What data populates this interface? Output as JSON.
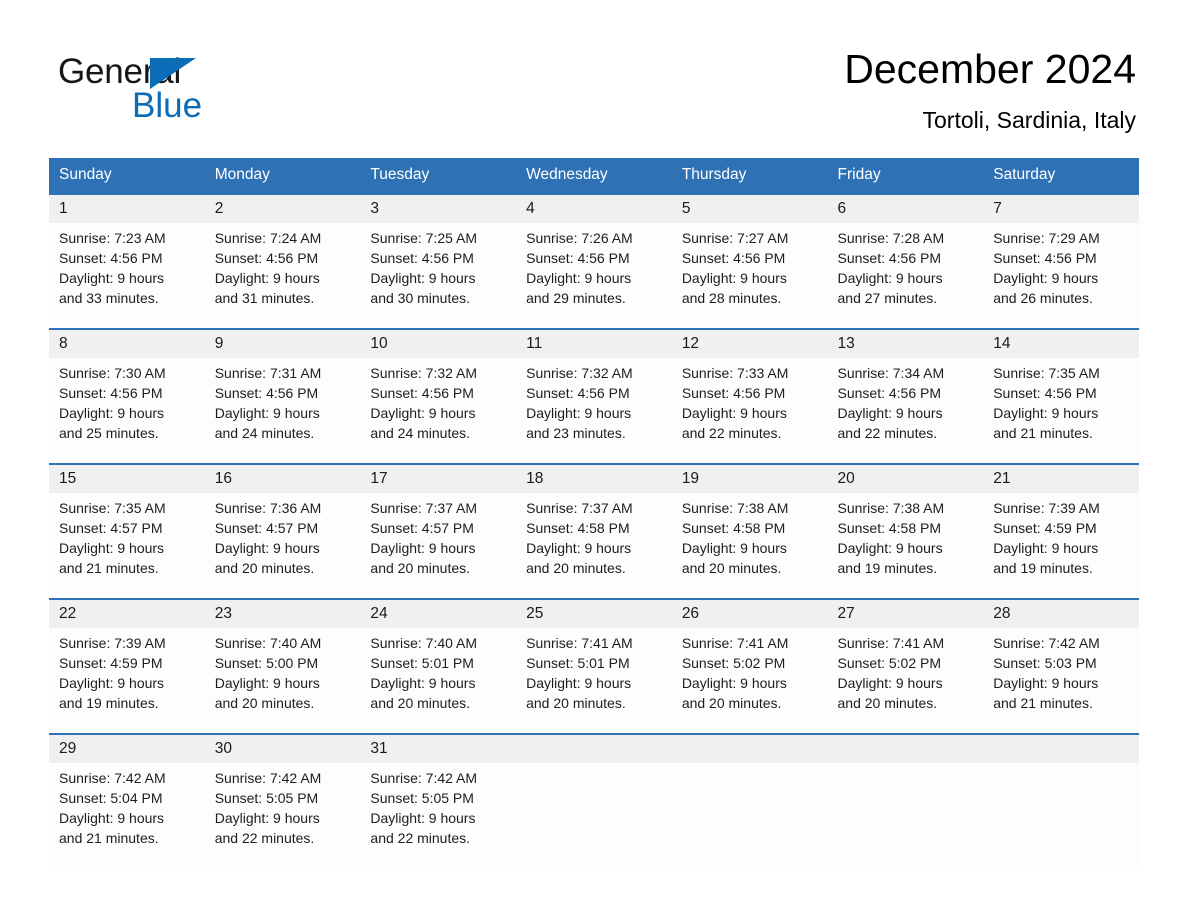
{
  "brand": {
    "name_part1": "General",
    "name_part2": "Blue",
    "accent_color": "#0b6cb7"
  },
  "header": {
    "title": "December 2024",
    "subtitle": "Tortoli, Sardinia, Italy"
  },
  "theme": {
    "header_blue": "#2e72b5",
    "daynum_band": "#f0f0f0",
    "cell_background": "#fdfdfd",
    "text_color": "#1d1d1d"
  },
  "weekday_headers": [
    "Sunday",
    "Monday",
    "Tuesday",
    "Wednesday",
    "Thursday",
    "Friday",
    "Saturday"
  ],
  "weeks": [
    [
      {
        "day": "1",
        "sunrise": "Sunrise: 7:23 AM",
        "sunset": "Sunset: 4:56 PM",
        "daylight_line1": "Daylight: 9 hours",
        "daylight_line2": "and 33 minutes."
      },
      {
        "day": "2",
        "sunrise": "Sunrise: 7:24 AM",
        "sunset": "Sunset: 4:56 PM",
        "daylight_line1": "Daylight: 9 hours",
        "daylight_line2": "and 31 minutes."
      },
      {
        "day": "3",
        "sunrise": "Sunrise: 7:25 AM",
        "sunset": "Sunset: 4:56 PM",
        "daylight_line1": "Daylight: 9 hours",
        "daylight_line2": "and 30 minutes."
      },
      {
        "day": "4",
        "sunrise": "Sunrise: 7:26 AM",
        "sunset": "Sunset: 4:56 PM",
        "daylight_line1": "Daylight: 9 hours",
        "daylight_line2": "and 29 minutes."
      },
      {
        "day": "5",
        "sunrise": "Sunrise: 7:27 AM",
        "sunset": "Sunset: 4:56 PM",
        "daylight_line1": "Daylight: 9 hours",
        "daylight_line2": "and 28 minutes."
      },
      {
        "day": "6",
        "sunrise": "Sunrise: 7:28 AM",
        "sunset": "Sunset: 4:56 PM",
        "daylight_line1": "Daylight: 9 hours",
        "daylight_line2": "and 27 minutes."
      },
      {
        "day": "7",
        "sunrise": "Sunrise: 7:29 AM",
        "sunset": "Sunset: 4:56 PM",
        "daylight_line1": "Daylight: 9 hours",
        "daylight_line2": "and 26 minutes."
      }
    ],
    [
      {
        "day": "8",
        "sunrise": "Sunrise: 7:30 AM",
        "sunset": "Sunset: 4:56 PM",
        "daylight_line1": "Daylight: 9 hours",
        "daylight_line2": "and 25 minutes."
      },
      {
        "day": "9",
        "sunrise": "Sunrise: 7:31 AM",
        "sunset": "Sunset: 4:56 PM",
        "daylight_line1": "Daylight: 9 hours",
        "daylight_line2": "and 24 minutes."
      },
      {
        "day": "10",
        "sunrise": "Sunrise: 7:32 AM",
        "sunset": "Sunset: 4:56 PM",
        "daylight_line1": "Daylight: 9 hours",
        "daylight_line2": "and 24 minutes."
      },
      {
        "day": "11",
        "sunrise": "Sunrise: 7:32 AM",
        "sunset": "Sunset: 4:56 PM",
        "daylight_line1": "Daylight: 9 hours",
        "daylight_line2": "and 23 minutes."
      },
      {
        "day": "12",
        "sunrise": "Sunrise: 7:33 AM",
        "sunset": "Sunset: 4:56 PM",
        "daylight_line1": "Daylight: 9 hours",
        "daylight_line2": "and 22 minutes."
      },
      {
        "day": "13",
        "sunrise": "Sunrise: 7:34 AM",
        "sunset": "Sunset: 4:56 PM",
        "daylight_line1": "Daylight: 9 hours",
        "daylight_line2": "and 22 minutes."
      },
      {
        "day": "14",
        "sunrise": "Sunrise: 7:35 AM",
        "sunset": "Sunset: 4:56 PM",
        "daylight_line1": "Daylight: 9 hours",
        "daylight_line2": "and 21 minutes."
      }
    ],
    [
      {
        "day": "15",
        "sunrise": "Sunrise: 7:35 AM",
        "sunset": "Sunset: 4:57 PM",
        "daylight_line1": "Daylight: 9 hours",
        "daylight_line2": "and 21 minutes."
      },
      {
        "day": "16",
        "sunrise": "Sunrise: 7:36 AM",
        "sunset": "Sunset: 4:57 PM",
        "daylight_line1": "Daylight: 9 hours",
        "daylight_line2": "and 20 minutes."
      },
      {
        "day": "17",
        "sunrise": "Sunrise: 7:37 AM",
        "sunset": "Sunset: 4:57 PM",
        "daylight_line1": "Daylight: 9 hours",
        "daylight_line2": "and 20 minutes."
      },
      {
        "day": "18",
        "sunrise": "Sunrise: 7:37 AM",
        "sunset": "Sunset: 4:58 PM",
        "daylight_line1": "Daylight: 9 hours",
        "daylight_line2": "and 20 minutes."
      },
      {
        "day": "19",
        "sunrise": "Sunrise: 7:38 AM",
        "sunset": "Sunset: 4:58 PM",
        "daylight_line1": "Daylight: 9 hours",
        "daylight_line2": "and 20 minutes."
      },
      {
        "day": "20",
        "sunrise": "Sunrise: 7:38 AM",
        "sunset": "Sunset: 4:58 PM",
        "daylight_line1": "Daylight: 9 hours",
        "daylight_line2": "and 19 minutes."
      },
      {
        "day": "21",
        "sunrise": "Sunrise: 7:39 AM",
        "sunset": "Sunset: 4:59 PM",
        "daylight_line1": "Daylight: 9 hours",
        "daylight_line2": "and 19 minutes."
      }
    ],
    [
      {
        "day": "22",
        "sunrise": "Sunrise: 7:39 AM",
        "sunset": "Sunset: 4:59 PM",
        "daylight_line1": "Daylight: 9 hours",
        "daylight_line2": "and 19 minutes."
      },
      {
        "day": "23",
        "sunrise": "Sunrise: 7:40 AM",
        "sunset": "Sunset: 5:00 PM",
        "daylight_line1": "Daylight: 9 hours",
        "daylight_line2": "and 20 minutes."
      },
      {
        "day": "24",
        "sunrise": "Sunrise: 7:40 AM",
        "sunset": "Sunset: 5:01 PM",
        "daylight_line1": "Daylight: 9 hours",
        "daylight_line2": "and 20 minutes."
      },
      {
        "day": "25",
        "sunrise": "Sunrise: 7:41 AM",
        "sunset": "Sunset: 5:01 PM",
        "daylight_line1": "Daylight: 9 hours",
        "daylight_line2": "and 20 minutes."
      },
      {
        "day": "26",
        "sunrise": "Sunrise: 7:41 AM",
        "sunset": "Sunset: 5:02 PM",
        "daylight_line1": "Daylight: 9 hours",
        "daylight_line2": "and 20 minutes."
      },
      {
        "day": "27",
        "sunrise": "Sunrise: 7:41 AM",
        "sunset": "Sunset: 5:02 PM",
        "daylight_line1": "Daylight: 9 hours",
        "daylight_line2": "and 20 minutes."
      },
      {
        "day": "28",
        "sunrise": "Sunrise: 7:42 AM",
        "sunset": "Sunset: 5:03 PM",
        "daylight_line1": "Daylight: 9 hours",
        "daylight_line2": "and 21 minutes."
      }
    ],
    [
      {
        "day": "29",
        "sunrise": "Sunrise: 7:42 AM",
        "sunset": "Sunset: 5:04 PM",
        "daylight_line1": "Daylight: 9 hours",
        "daylight_line2": "and 21 minutes."
      },
      {
        "day": "30",
        "sunrise": "Sunrise: 7:42 AM",
        "sunset": "Sunset: 5:05 PM",
        "daylight_line1": "Daylight: 9 hours",
        "daylight_line2": "and 22 minutes."
      },
      {
        "day": "31",
        "sunrise": "Sunrise: 7:42 AM",
        "sunset": "Sunset: 5:05 PM",
        "daylight_line1": "Daylight: 9 hours",
        "daylight_line2": "and 22 minutes."
      },
      {
        "day": "",
        "sunrise": "",
        "sunset": "",
        "daylight_line1": "",
        "daylight_line2": ""
      },
      {
        "day": "",
        "sunrise": "",
        "sunset": "",
        "daylight_line1": "",
        "daylight_line2": ""
      },
      {
        "day": "",
        "sunrise": "",
        "sunset": "",
        "daylight_line1": "",
        "daylight_line2": ""
      },
      {
        "day": "",
        "sunrise": "",
        "sunset": "",
        "daylight_line1": "",
        "daylight_line2": ""
      }
    ]
  ]
}
